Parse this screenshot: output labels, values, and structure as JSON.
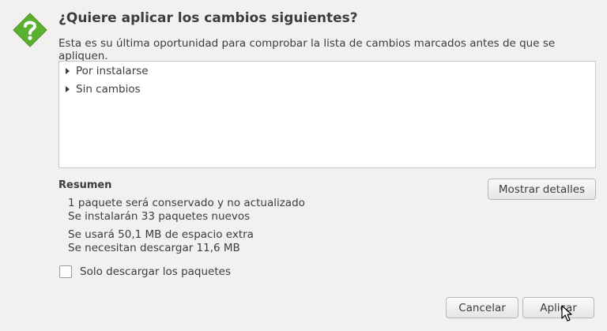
{
  "dialog": {
    "title": "¿Quiere aplicar los cambios siguientes?",
    "subtitle": "Esta es su última oportunidad para comprobar la lista de cambios marcados antes de que se apliquen.",
    "icon": "question-diamond-icon",
    "accent": "#5cb030"
  },
  "tree": {
    "items": [
      {
        "label": "Por instalarse"
      },
      {
        "label": "Sin cambios"
      }
    ]
  },
  "summary": {
    "heading": "Resumen",
    "lines": [
      "1 paquete será conservado y no actualizado",
      "Se instalarán 33 paquetes nuevos",
      "Se usará 50,1 MB de espacio extra",
      "Se necesitan descargar 11,6 MB"
    ]
  },
  "buttons": {
    "details": "Mostrar detalles",
    "cancel": "Cancelar",
    "apply": "Aplicar"
  },
  "options": {
    "download_only_label": "Solo descargar los paquetes",
    "download_only_checked": false
  }
}
